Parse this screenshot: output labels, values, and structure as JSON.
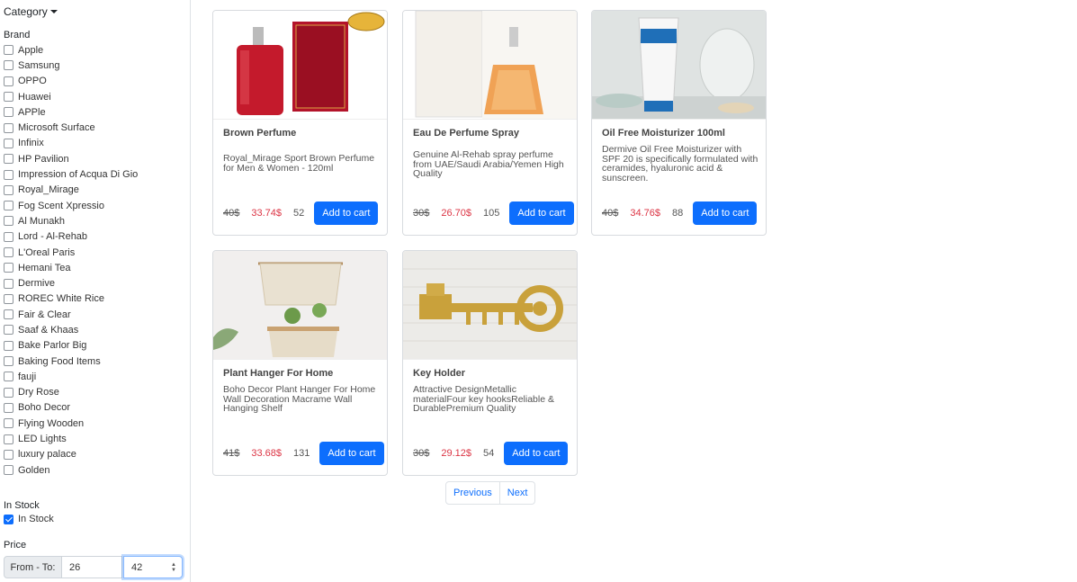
{
  "sidebar": {
    "category_label": "Category",
    "brand_title": "Brand",
    "brands": [
      "Apple",
      "Samsung",
      "OPPO",
      "Huawei",
      "APPle",
      "Microsoft Surface",
      "Infinix",
      "HP Pavilion",
      "Impression of Acqua Di Gio",
      "Royal_Mirage",
      "Fog Scent Xpressio",
      "Al Munakh",
      "Lord - Al-Rehab",
      "L'Oreal Paris",
      "Hemani Tea",
      "Dermive",
      "ROREC White Rice",
      "Fair & Clear",
      "Saaf & Khaas",
      "Bake Parlor Big",
      "Baking Food Items",
      "fauji",
      "Dry Rose",
      "Boho Decor",
      "Flying Wooden",
      "LED Lights",
      "luxury palace",
      "Golden"
    ],
    "stock_title": "In Stock",
    "stock_label": "In Stock",
    "stock_checked": true,
    "price_title": "Price",
    "price_prefix": "From - To:",
    "price_from": "26",
    "price_to": "42"
  },
  "products": [
    {
      "title": "Brown Perfume",
      "desc": "Royal_Mirage Sport Brown Perfume for Men & Women - 120ml",
      "old_price": "40$",
      "new_price": "33.74$",
      "count": "52",
      "button": "Add to cart",
      "icon": "perfume-bottle-image"
    },
    {
      "title": "Eau De Perfume Spray",
      "desc": "Genuine Al-Rehab spray perfume from UAE/Saudi Arabia/Yemen High Quality",
      "old_price": "30$",
      "new_price": "26.70$",
      "count": "105",
      "button": "Add to cart",
      "icon": "perfume-spray-image"
    },
    {
      "title": "Oil Free Moisturizer 100ml",
      "desc": "Dermive Oil Free Moisturizer with SPF 20 is specifically formulated with ceramides, hyaluronic acid & sunscreen.",
      "old_price": "40$",
      "new_price": "34.76$",
      "count": "88",
      "button": "Add to cart",
      "icon": "moisturizer-tube-image"
    },
    {
      "title": "Plant Hanger For Home",
      "desc": "Boho Decor Plant Hanger For Home Wall Decoration Macrame Wall Hanging Shelf",
      "old_price": "41$",
      "new_price": "33.68$",
      "count": "131",
      "button": "Add to cart",
      "icon": "macrame-shelf-image"
    },
    {
      "title": "Key Holder",
      "desc": "Attractive DesignMetallic materialFour key hooksReliable & DurablePremium Quality",
      "old_price": "30$",
      "new_price": "29.12$",
      "count": "54",
      "button": "Add to cart",
      "icon": "key-holder-image"
    }
  ],
  "pagination": {
    "prev": "Previous",
    "next": "Next"
  },
  "colors": {
    "primary": "#0d6efd",
    "discount": "#dc3545"
  }
}
